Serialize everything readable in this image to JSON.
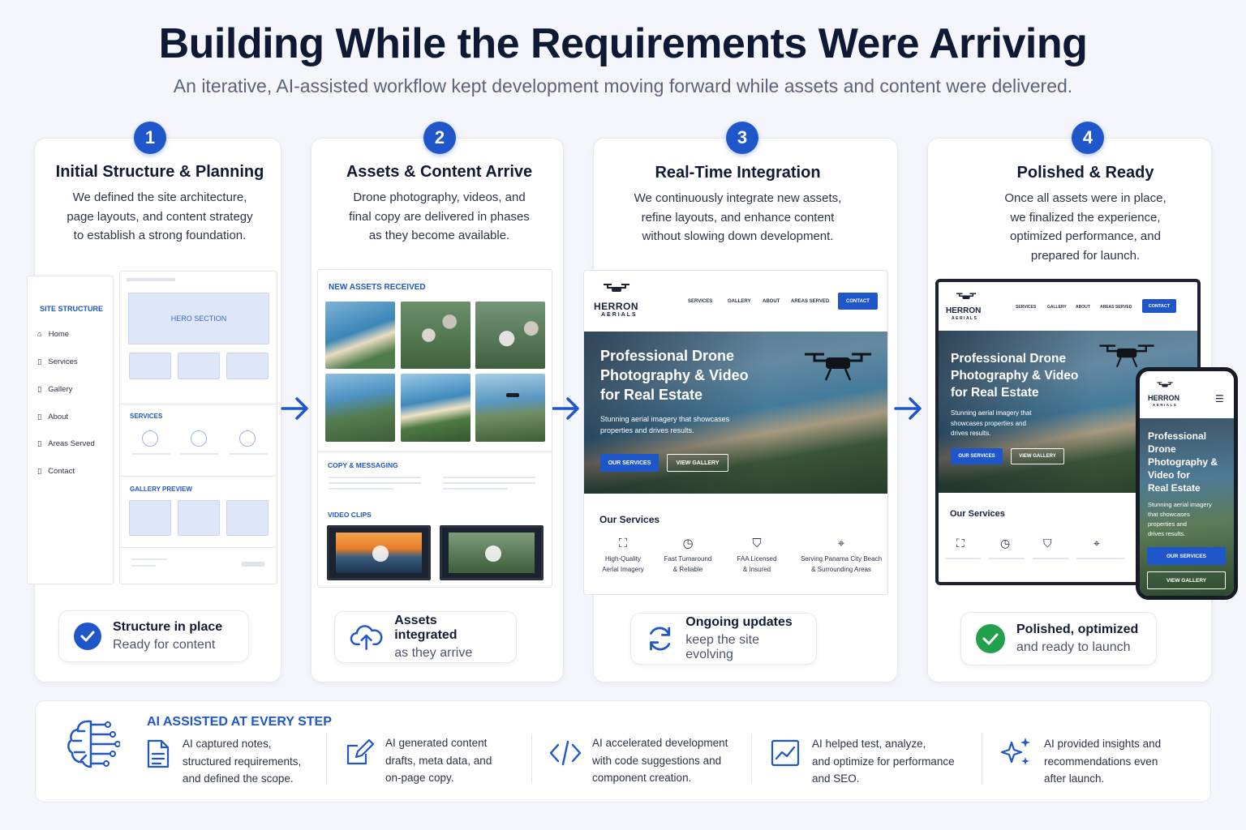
{
  "header": {
    "title": "Building While the Requirements Were Arriving",
    "subtitle": "An iterative, AI-assisted workflow kept development moving forward while assets and content were delivered."
  },
  "steps": [
    {
      "number": "1",
      "title": "Initial Structure & Planning",
      "desc": [
        "We defined the site architecture,",
        "page layouts, and content strategy",
        "to establish a strong foundation."
      ],
      "status1": "Structure in place",
      "status2": "Ready for content"
    },
    {
      "number": "2",
      "title": "Assets & Content Arrive",
      "desc": [
        "Drone photography, videos, and",
        "final copy are delivered in phases",
        "as they become available."
      ],
      "status1": "Assets integrated",
      "status2": "as they arrive"
    },
    {
      "number": "3",
      "title": "Real-Time Integration",
      "desc": [
        "We continuously integrate new assets,",
        "refine layouts, and enhance content",
        "without slowing down development."
      ],
      "status1": "Ongoing updates",
      "status2": "keep the site evolving"
    },
    {
      "number": "4",
      "title": "Polished & Ready",
      "desc": [
        "Once all assets were in place,",
        "we finalized the experience,",
        "optimized performance, and",
        "prepared for launch."
      ],
      "status1": "Polished, optimized",
      "status2": "and ready to launch"
    }
  ],
  "wireframe": {
    "site_structure": "SITE STRUCTURE",
    "nav": [
      "Home",
      "Services",
      "Gallery",
      "About",
      "Areas Served",
      "Contact"
    ],
    "hero": "HERO SECTION",
    "services": "SERVICES",
    "gallery": "GALLERY PREVIEW"
  },
  "assets": {
    "heading": "NEW ASSETS RECEIVED",
    "copy": "COPY & MESSAGING",
    "video": "VIDEO CLIPS"
  },
  "site": {
    "brand": "HERRON",
    "brand_sub": "AERIALS",
    "nav": [
      "SERVICES",
      "GALLERY",
      "ABOUT",
      "AREAS SERVED"
    ],
    "contact": "CONTACT",
    "hero_l1": "Professional Drone",
    "hero_l2": "Photography & Video",
    "hero_l3": "for Real Estate",
    "hero_sub1": "Stunning aerial imagery that showcases",
    "hero_sub2": "properties and drives results.",
    "btn_services": "OUR SERVICES",
    "btn_gallery": "VIEW GALLERY",
    "our_services": "Our Services",
    "services": [
      {
        "l1": "High-Quality",
        "l2": "Aerial Imagery"
      },
      {
        "l1": "Fast Turnaround",
        "l2": "& Reliable"
      },
      {
        "l1": "FAA Licensed",
        "l2": "& Insured"
      },
      {
        "l1": "Serving Panama City Beach",
        "l2": "& Surrounding Areas"
      }
    ],
    "final_sub1": "Stunning aerial imagery that",
    "final_sub2": "showcases properties and",
    "final_sub3": "drives results.",
    "mobile_l1": "Professional",
    "mobile_l2": "Drone",
    "mobile_l3": "Photography &",
    "mobile_l4": "Video for",
    "mobile_l5": "Real Estate",
    "mobile_sub1": "Stunning aerial imagery",
    "mobile_sub2": "that showcases",
    "mobile_sub3": "properties and",
    "mobile_sub4": "drives results."
  },
  "ai": {
    "heading": "AI ASSISTED AT EVERY STEP",
    "items": [
      {
        "icon": "document-icon",
        "lines": [
          "AI captured notes,",
          "structured requirements,",
          "and defined the scope."
        ]
      },
      {
        "icon": "edit-icon",
        "lines": [
          "AI generated content",
          "drafts, meta data, and",
          "on-page copy."
        ]
      },
      {
        "icon": "code-icon",
        "lines": [
          "AI accelerated development",
          "with code suggestions and",
          "component creation."
        ]
      },
      {
        "icon": "chart-icon",
        "lines": [
          "AI helped test, analyze,",
          "and optimize for performance",
          "and SEO."
        ]
      },
      {
        "icon": "sparkle-icon",
        "lines": [
          "AI provided insights and",
          "recommendations even",
          "after launch."
        ]
      }
    ]
  },
  "colors": {
    "accent": "#1f56c9",
    "success": "#22a04b",
    "ink": "#0e1a35"
  }
}
